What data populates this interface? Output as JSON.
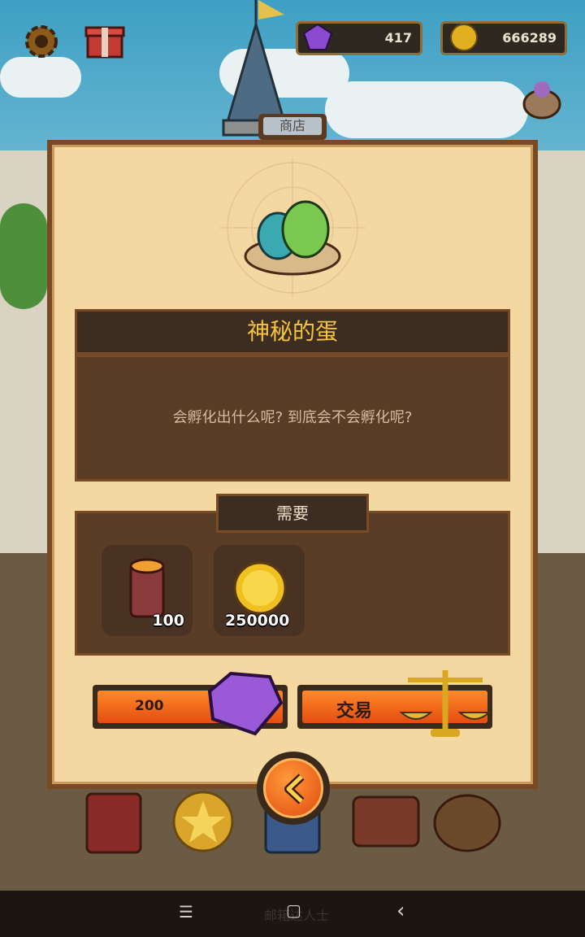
{
  "hud": {
    "gems": "417",
    "coins": "666289",
    "icons": [
      "gear-icon",
      "gift-icon",
      "gem-icon",
      "coin-icon",
      "pouch-icon"
    ]
  },
  "shop": {
    "tab_label": "商店",
    "item_title": "神秘的蛋",
    "item_description": "会孵化出什么呢? 到底会不会孵化呢?",
    "requirement_label": "需要",
    "requirements": [
      {
        "icon": "wood-log-icon",
        "amount": "100"
      },
      {
        "icon": "gold-coin-icon",
        "amount": "250000"
      }
    ],
    "gem_price": "200",
    "trade_label": "交易"
  },
  "system_nav": {
    "menu": "☰",
    "home": "▢",
    "back": "‹",
    "watermark": "邮箱达人士"
  },
  "colors": {
    "title_gold": "#f6c43a",
    "button_orange": "#f0651a",
    "panel_parchment": "#f4d8a2",
    "panel_dark": "#5a3d26"
  }
}
